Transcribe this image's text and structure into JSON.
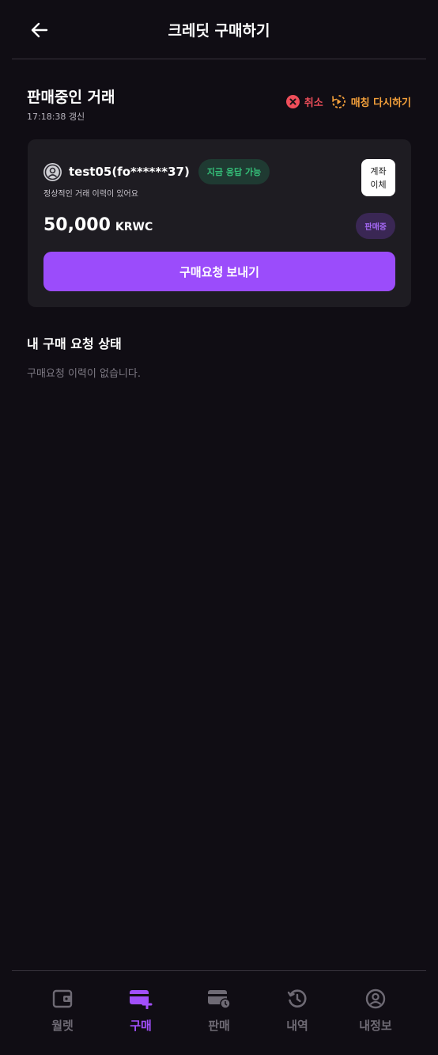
{
  "header": {
    "title": "크레딧 구매하기"
  },
  "selling": {
    "title": "판매중인 거래",
    "refresh_time": "17:18:38 갱신",
    "cancel_label": "취소",
    "rematch_label": "매칭 다시하기"
  },
  "card": {
    "username": "test05(fo******37)",
    "respond_badge": "지금 응답 가능",
    "history_text": "정상적인 거래 이력이 있어요",
    "transfer_line1": "계좌",
    "transfer_line2": "이체",
    "amount": "50,000",
    "unit": "KRWC",
    "status_badge": "판매중",
    "send_button": "구매요청 보내기"
  },
  "my_requests": {
    "title": "내 구매 요청 상태",
    "empty_text": "구매요청 이력이 없습니다."
  },
  "nav": {
    "items": [
      {
        "label": "월렛",
        "icon": "wallet-icon"
      },
      {
        "label": "구매",
        "icon": "card-plus-icon"
      },
      {
        "label": "판매",
        "icon": "card-clock-icon"
      },
      {
        "label": "내역",
        "icon": "history-icon"
      },
      {
        "label": "내정보",
        "icon": "profile-icon"
      }
    ],
    "active": "구매"
  },
  "colors": {
    "accent": "#9b4cfb",
    "cancel": "#ef4e5a",
    "rematch": "#f5a13b",
    "available": "#35c27a",
    "background": "#100d14"
  }
}
